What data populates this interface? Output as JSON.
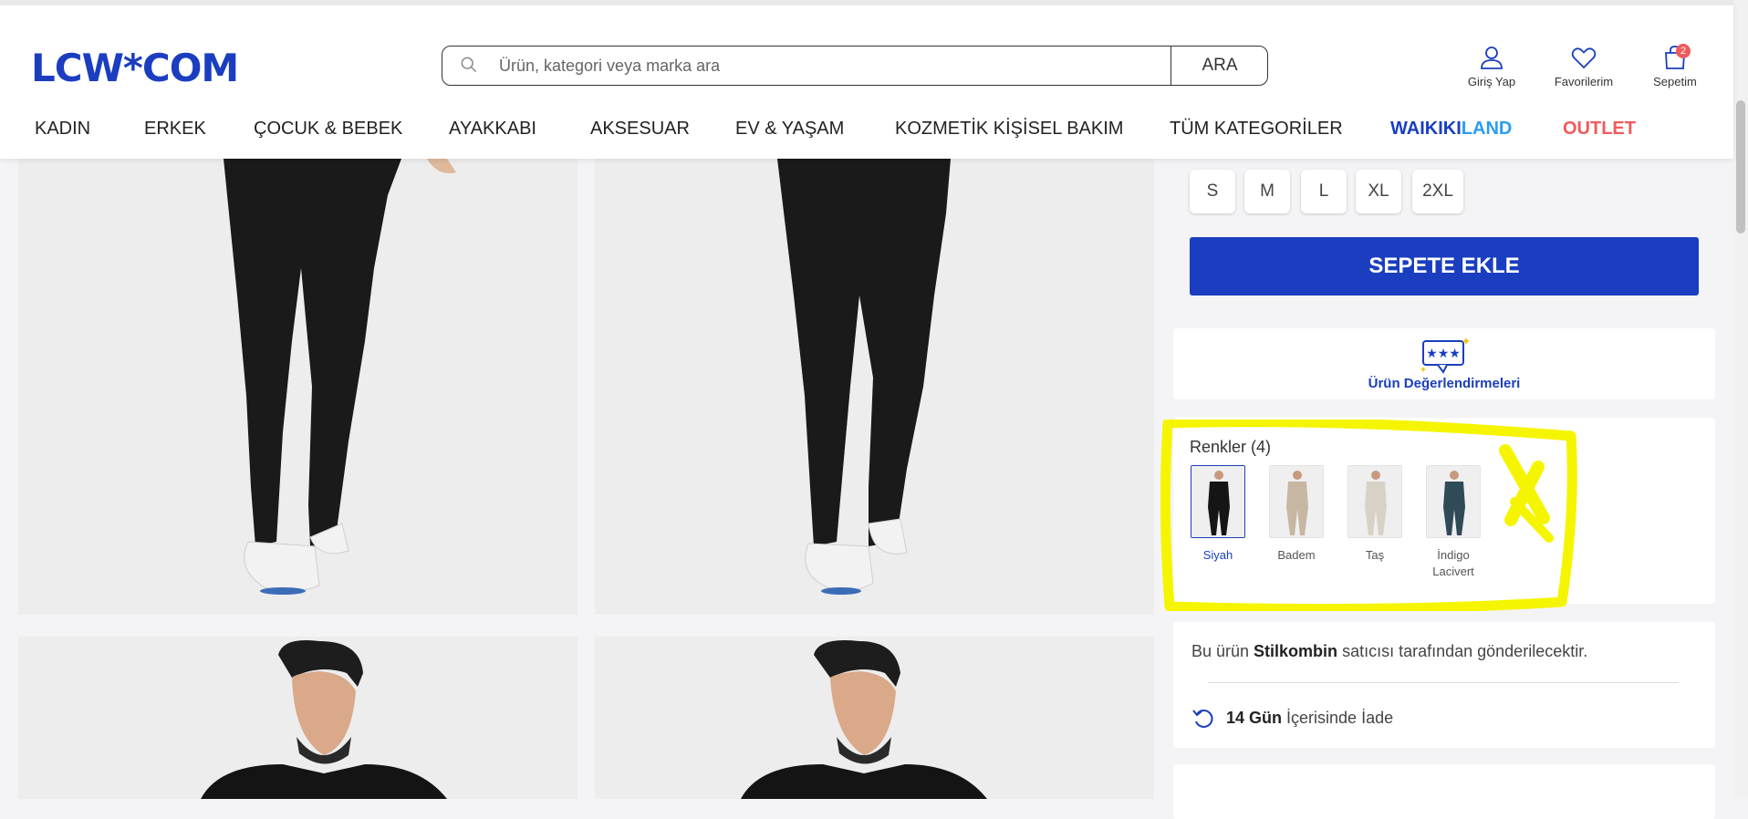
{
  "header": {
    "logo": "LCW*COM",
    "search": {
      "placeholder": "Ürün, kategori veya marka ara",
      "button": "ARA"
    },
    "actions": {
      "login": "Giriş Yap",
      "favorites": "Favorilerim",
      "cart": "Sepetim",
      "cart_count": "2"
    }
  },
  "nav": {
    "items": [
      "KADIN",
      "ERKEK",
      "ÇOCUK & BEBEK",
      "AYAKKABI",
      "AKSESUAR",
      "EV & YAŞAM",
      "KOZMETİK KİŞİSEL BAKIM",
      "TÜM KATEGORİLER"
    ],
    "waikiki_part1": "WAIKIKI",
    "waikiki_part2": "LAND",
    "outlet": "OUTLET"
  },
  "product": {
    "sizes": [
      "S",
      "M",
      "L",
      "XL",
      "2XL"
    ],
    "add_to_cart": "SEPETE EKLE",
    "reviews_label": "Ürün Değerlendirmeleri",
    "colors_title": "Renkler (4)",
    "colors": [
      {
        "name": "Siyah",
        "selected": true,
        "swatch": "#151515"
      },
      {
        "name": "Badem",
        "selected": false,
        "swatch": "#c7b6a2"
      },
      {
        "name": "Taş",
        "selected": false,
        "swatch": "#d8d2c6"
      },
      {
        "name": "İndigo Lacivert",
        "line1": "İndigo",
        "line2": "Lacivert",
        "selected": false,
        "swatch": "#2f4b57"
      }
    ],
    "seller": {
      "prefix": "Bu ürün ",
      "name": "Stilkombin",
      "suffix": " satıcısı tarafından gönderilecektir."
    },
    "return_policy": {
      "bold": "14 Gün",
      "rest": "İçerisinde İade"
    }
  },
  "colors": {
    "brand": "#1a3ebf",
    "accent_light": "#2a9df4",
    "outlet": "#f05a5a",
    "highlight": "#f5f500"
  }
}
